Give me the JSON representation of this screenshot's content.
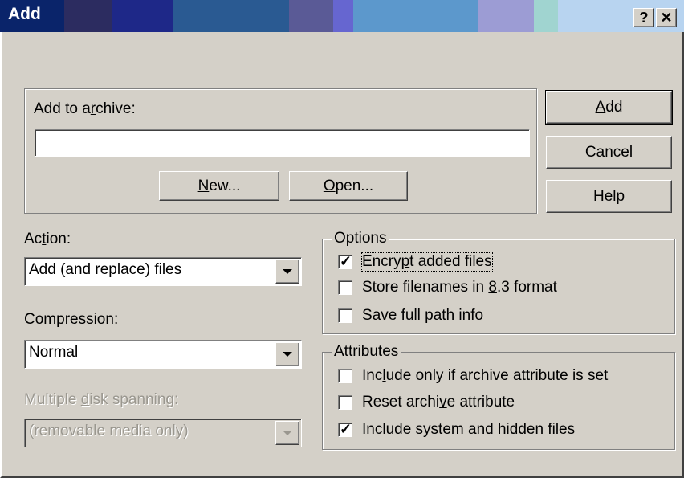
{
  "window": {
    "title": "Add",
    "help_glyph": "?",
    "close_glyph": "✕"
  },
  "archive": {
    "label_pre": "Add to a",
    "label_u": "r",
    "label_post": "chive:",
    "value": "",
    "new_u": "N",
    "new_post": "ew...",
    "open_u": "O",
    "open_post": "pen..."
  },
  "buttons": {
    "add_u": "A",
    "add_post": "dd",
    "cancel": "Cancel",
    "help_u": "H",
    "help_post": "elp"
  },
  "action": {
    "label_pre": "Ac",
    "label_u": "t",
    "label_post": "ion:",
    "value": "Add (and replace) files"
  },
  "compression": {
    "label_u": "C",
    "label_post": "ompression:",
    "value": "Normal"
  },
  "spanning": {
    "label_pre": "Multiple ",
    "label_u": "d",
    "label_post": "isk spanning:",
    "value": "(removable media only)"
  },
  "options": {
    "legend": "Options",
    "encrypt": {
      "pre": "Encry",
      "u": "p",
      "post": "t added files",
      "checked": true
    },
    "store83": {
      "pre": "Store filenames in ",
      "u": "8",
      "post": ".3 format",
      "checked": false
    },
    "fullpath": {
      "pre": "",
      "u": "S",
      "post": "ave full path info",
      "checked": false
    }
  },
  "attributes": {
    "legend": "Attributes",
    "include_archive": {
      "pre": "Inc",
      "u": "l",
      "post": "ude only if archive attribute is set",
      "checked": false
    },
    "reset_archive": {
      "pre": "Reset archi",
      "u": "v",
      "post": "e attribute",
      "checked": false
    },
    "include_system": {
      "pre": "Include s",
      "u": "y",
      "post": "stem and hidden files",
      "checked": true
    }
  },
  "check_glyph": "✓",
  "colors": {
    "title_bands": [
      "#0a246a",
      "#3a3a6c",
      "#1e2c8c",
      "#2a5f96",
      "#3474a8",
      "#5c5c98",
      "#6a6ad0",
      "#5e9ad0",
      "#7aa8d8",
      "#9c9cd4",
      "#a0d4d0",
      "#b4d2ec",
      "#c8dcf4"
    ],
    "face": "#d4d0c8"
  }
}
